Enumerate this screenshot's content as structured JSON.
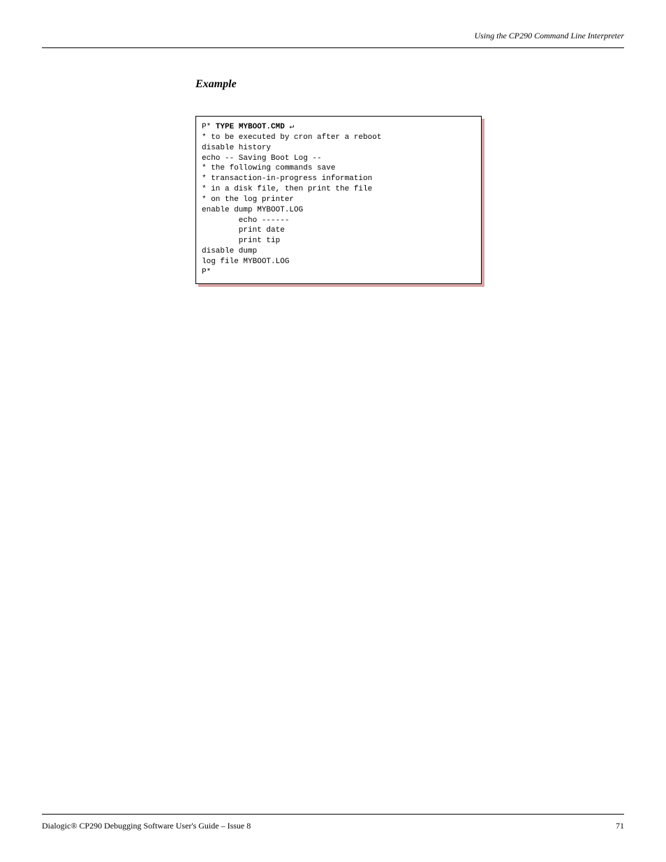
{
  "header": {
    "right": "Using the CP290 Command Line Interpreter"
  },
  "section": {
    "title": "Example"
  },
  "code": {
    "prompt1": "P*",
    "cmd": "TYPE MYBOOT.CMD",
    "return": "↵",
    "line2": "* to be executed by cron after a reboot",
    "line3": "disable history",
    "line4": "echo -- Saving Boot Log --",
    "line5": "* the following commands save",
    "line6": "* transaction-in-progress information",
    "line7": "* in a disk file, then print the file",
    "line8": "* on the log printer",
    "line9": "enable dump MYBOOT.LOG",
    "line10": "        echo ------",
    "line11": "        print date",
    "line12": "        print tip",
    "line13": "disable dump",
    "line14": "log file MYBOOT.LOG",
    "prompt2": "P*"
  },
  "footer": {
    "left": "Dialogic® CP290 Debugging Software User's Guide – Issue 8",
    "right": "71"
  }
}
